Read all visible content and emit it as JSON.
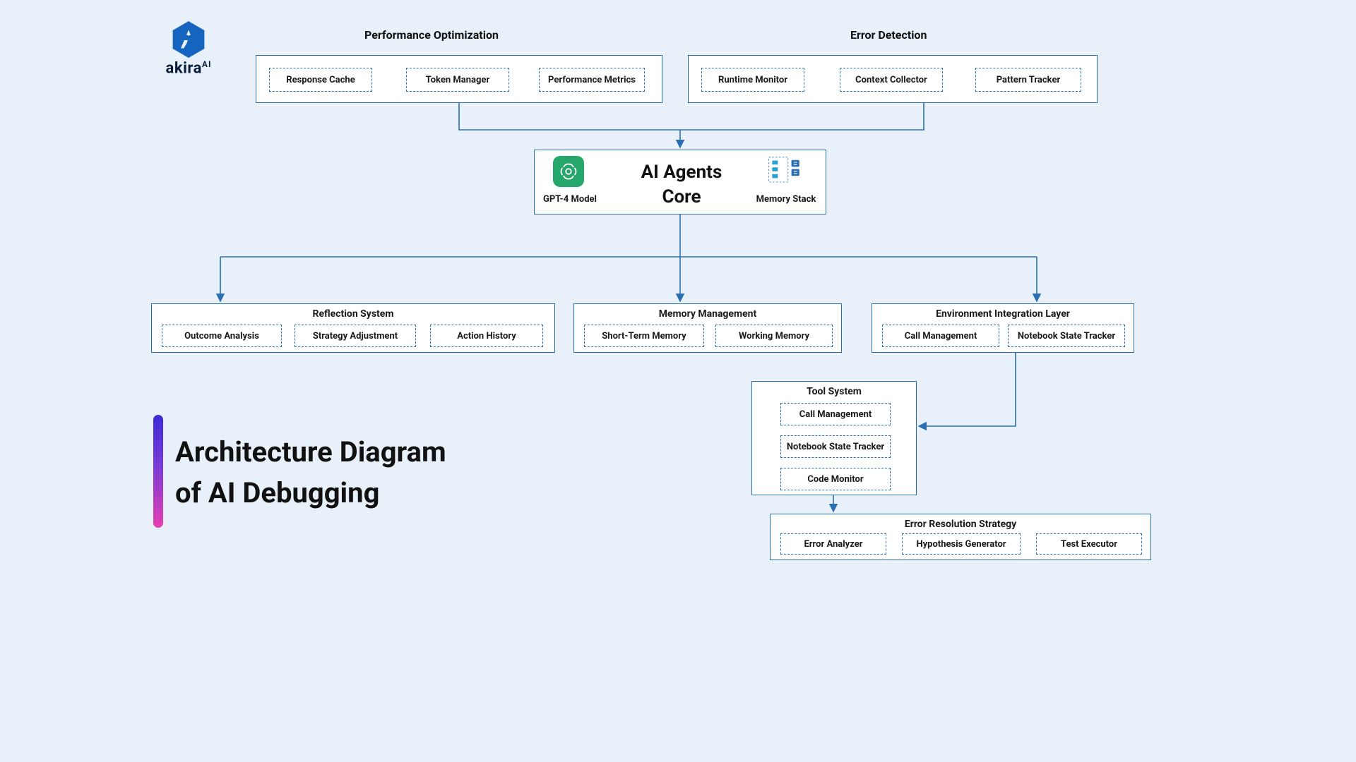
{
  "logo": {
    "brand": "akira",
    "suffix": "AI"
  },
  "page_title_line1": "Architecture Diagram",
  "page_title_line2": "of AI Debugging",
  "top": {
    "left": {
      "title": "Performance Optimization",
      "items": [
        "Response Cache",
        "Token Manager",
        "Performance Metrics"
      ]
    },
    "right": {
      "title": "Error Detection",
      "items": [
        "Runtime Monitor",
        "Context Collector",
        "Pattern Tracker"
      ]
    }
  },
  "core": {
    "title": "AI Agents Core",
    "left_label": "GPT-4 Model",
    "right_label": "Memory Stack"
  },
  "mid": {
    "reflection": {
      "title": "Reflection System",
      "items": [
        "Outcome Analysis",
        "Strategy Adjustment",
        "Action History"
      ]
    },
    "memory": {
      "title": "Memory Management",
      "items": [
        "Short-Term Memory",
        "Working Memory"
      ]
    },
    "env": {
      "title": "Environment Integration Layer",
      "items": [
        "Call Management",
        "Notebook State Tracker"
      ]
    }
  },
  "tool": {
    "title": "Tool System",
    "items": [
      "Call Management",
      "Notebook State Tracker",
      "Code Monitor"
    ]
  },
  "resolution": {
    "title": "Error Resolution Strategy",
    "items": [
      "Error Analyzer",
      "Hypothesis Generator",
      "Test Executor"
    ]
  }
}
